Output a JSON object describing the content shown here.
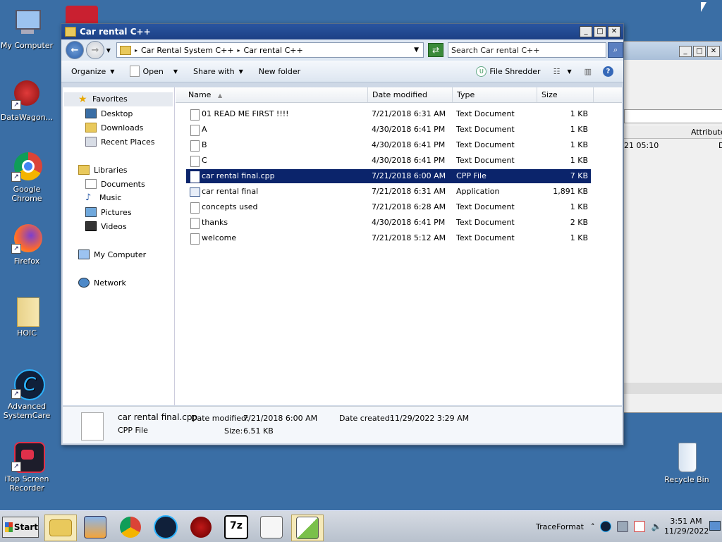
{
  "desktop": {
    "icons": [
      {
        "label": "My Computer"
      },
      {
        "label": "DataWagon..."
      },
      {
        "label": "Google Chrome"
      },
      {
        "label": "Firefox"
      },
      {
        "label": "HOIC"
      },
      {
        "label": "Advanced SystemCare"
      },
      {
        "label": "iTop Screen Recorder"
      },
      {
        "label": "Recycle Bin"
      }
    ]
  },
  "bg_window": {
    "column_header": "Attributes",
    "partial_value": "21 05:10",
    "partial_value2": "D"
  },
  "window": {
    "title": "Car rental C++",
    "controls": {
      "minimize": "_",
      "maximize": "□",
      "close": "✕"
    },
    "address": {
      "crumbs": [
        "Car Rental System C++",
        "Car rental C++"
      ],
      "search_placeholder": "Search Car rental C++"
    },
    "toolbar": {
      "organize": "Organize",
      "open": "Open",
      "share_with": "Share with",
      "new_folder": "New folder",
      "file_shredder": "File Shredder"
    },
    "nav": {
      "favorites": "Favorites",
      "desktop": "Desktop",
      "downloads": "Downloads",
      "recent_places": "Recent Places",
      "libraries": "Libraries",
      "documents": "Documents",
      "music": "Music",
      "pictures": "Pictures",
      "videos": "Videos",
      "my_computer": "My Computer",
      "network": "Network"
    },
    "columns": {
      "name": "Name",
      "date_modified": "Date modified",
      "type": "Type",
      "size": "Size"
    },
    "files": [
      {
        "name": "01 READ ME FIRST !!!!",
        "date": "7/21/2018 6:31 AM",
        "type": "Text Document",
        "size": "1 KB",
        "selected": false
      },
      {
        "name": "A",
        "date": "4/30/2018 6:41 PM",
        "type": "Text Document",
        "size": "1 KB",
        "selected": false
      },
      {
        "name": "B",
        "date": "4/30/2018 6:41 PM",
        "type": "Text Document",
        "size": "1 KB",
        "selected": false
      },
      {
        "name": "C",
        "date": "4/30/2018 6:41 PM",
        "type": "Text Document",
        "size": "1 KB",
        "selected": false
      },
      {
        "name": "car rental final.cpp",
        "date": "7/21/2018 6:00 AM",
        "type": "CPP File",
        "size": "7 KB",
        "selected": true
      },
      {
        "name": "car rental final",
        "date": "7/21/2018 6:31 AM",
        "type": "Application",
        "size": "1,891 KB",
        "selected": false
      },
      {
        "name": "concepts used",
        "date": "7/21/2018 6:28 AM",
        "type": "Text Document",
        "size": "1 KB",
        "selected": false
      },
      {
        "name": "thanks",
        "date": "4/30/2018 6:41 PM",
        "type": "Text Document",
        "size": "2 KB",
        "selected": false
      },
      {
        "name": "welcome",
        "date": "7/21/2018 5:12 AM",
        "type": "Text Document",
        "size": "1 KB",
        "selected": false
      }
    ],
    "details": {
      "filename": "car rental final.cpp",
      "filetype": "CPP File",
      "date_modified_label": "Date modified:",
      "date_modified": "7/21/2018 6:00 AM",
      "size_label": "Size:",
      "size": "6.51 KB",
      "date_created_label": "Date created:",
      "date_created": "11/29/2022 3:29 AM"
    }
  },
  "taskbar": {
    "start": "Start",
    "apps": [
      "file-explorer",
      "media-player",
      "chrome",
      "advanced-systemcare",
      "hoic-app",
      "7zip",
      "notepad",
      "chart-app"
    ],
    "tray_label": "TraceFormat",
    "time": "3:51 AM",
    "date": "11/29/2022"
  }
}
